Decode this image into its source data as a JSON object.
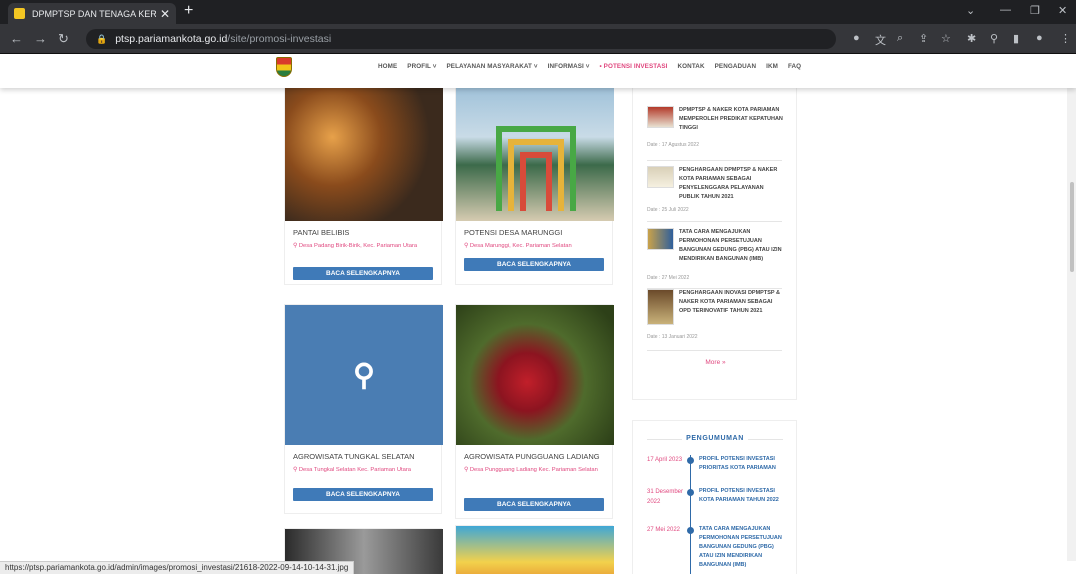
{
  "browser": {
    "tab_title": "DPMPTSP DAN TENAGA KERJA K",
    "tab_close": "✕",
    "new_tab": "+",
    "url_host": "ptsp.pariamankota.go.id",
    "url_path": "/site/promosi-investasi",
    "status_url": "https://ptsp.pariamankota.go.id/admin/images/promosi_investasi/21618-2022-09-14-10-14-31.jpg"
  },
  "menu": [
    "HOME",
    "PROFIL ˅",
    "PELAYANAN MASYARAKAT ˅",
    "INFORMASI ˅",
    "• POTENSI INVESTASI",
    "KONTAK",
    "PENGADUAN",
    "IKM",
    "FAQ"
  ],
  "cards": [
    {
      "title": "PANTAI BELIBIS",
      "location": "Desa Padang Birik-Birik, Kec. Pariaman Utara",
      "button": "BACA SELENGKAPNYA"
    },
    {
      "title": "POTENSI DESA MARUNGGI",
      "location": "Desa Marunggi, Kec. Pariaman Selatan",
      "button": "BACA SELENGKAPNYA"
    },
    {
      "title": "AGROWISATA TUNGKAL SELATAN",
      "location": "Desa Tungkal Selatan Kec. Pariaman Utara",
      "button": "BACA SELENGKAPNYA"
    },
    {
      "title": "AGROWISATA PUNGGUANG LADIANG",
      "location": "Desa Pungguang Ladiang Kec. Pariaman Selatan",
      "button": "BACA SELENGKAPNYA"
    }
  ],
  "news": [
    {
      "title": "DPMPTSP & NAKER KOTA PARIAMAN MEMPEROLEH PREDIKAT KEPATUHAN TINGGI",
      "date": "Date : 17 Agustus 2022"
    },
    {
      "title": "PENGHARGAAN DPMPTSP & NAKER KOTA PARIAMAN SEBAGAI PENYELENGGARA PELAYANAN PUBLIK TAHUN 2021",
      "date": "Date : 25 Juli 2022"
    },
    {
      "title": "TATA CARA MENGAJUKAN PERMOHONAN PERSETUJUAN BANGUNAN GEDUNG (PBG) ATAU IZIN MENDIRIKAN BANGUNAN (IMB)",
      "date": "Date : 27 Mei 2022"
    },
    {
      "title": "PENGHARGAAN INOVASI DPMPTSP & NAKER KOTA PARIAMAN SEBAGAI OPD TERINOVATIF TAHUN 2021",
      "date": "Date : 13 Januari 2022"
    }
  ],
  "news_more": "More »",
  "announcement_title": "PENGUMUMAN",
  "announcements": [
    {
      "date": "17 April 2023",
      "title": "PROFIL POTENSI INVESTASI PRIORITAS KOTA PARIAMAN"
    },
    {
      "date": "31 Desember 2022",
      "title": "PROFIL POTENSI INVESTASI KOTA PARIAMAN TAHUN 2022"
    },
    {
      "date": "27 Mei 2022",
      "title": "TATA CARA MENGAJUKAN PERMOHONAN PERSETUJUAN BANGUNAN GEDUNG (PBG) ATAU IZIN MENDIRIKAN BANGUNAN (IMB)"
    }
  ],
  "colors": {
    "accent": "#e0487f",
    "button": "#3f7ab8",
    "placeholder": "#4a7db3"
  }
}
